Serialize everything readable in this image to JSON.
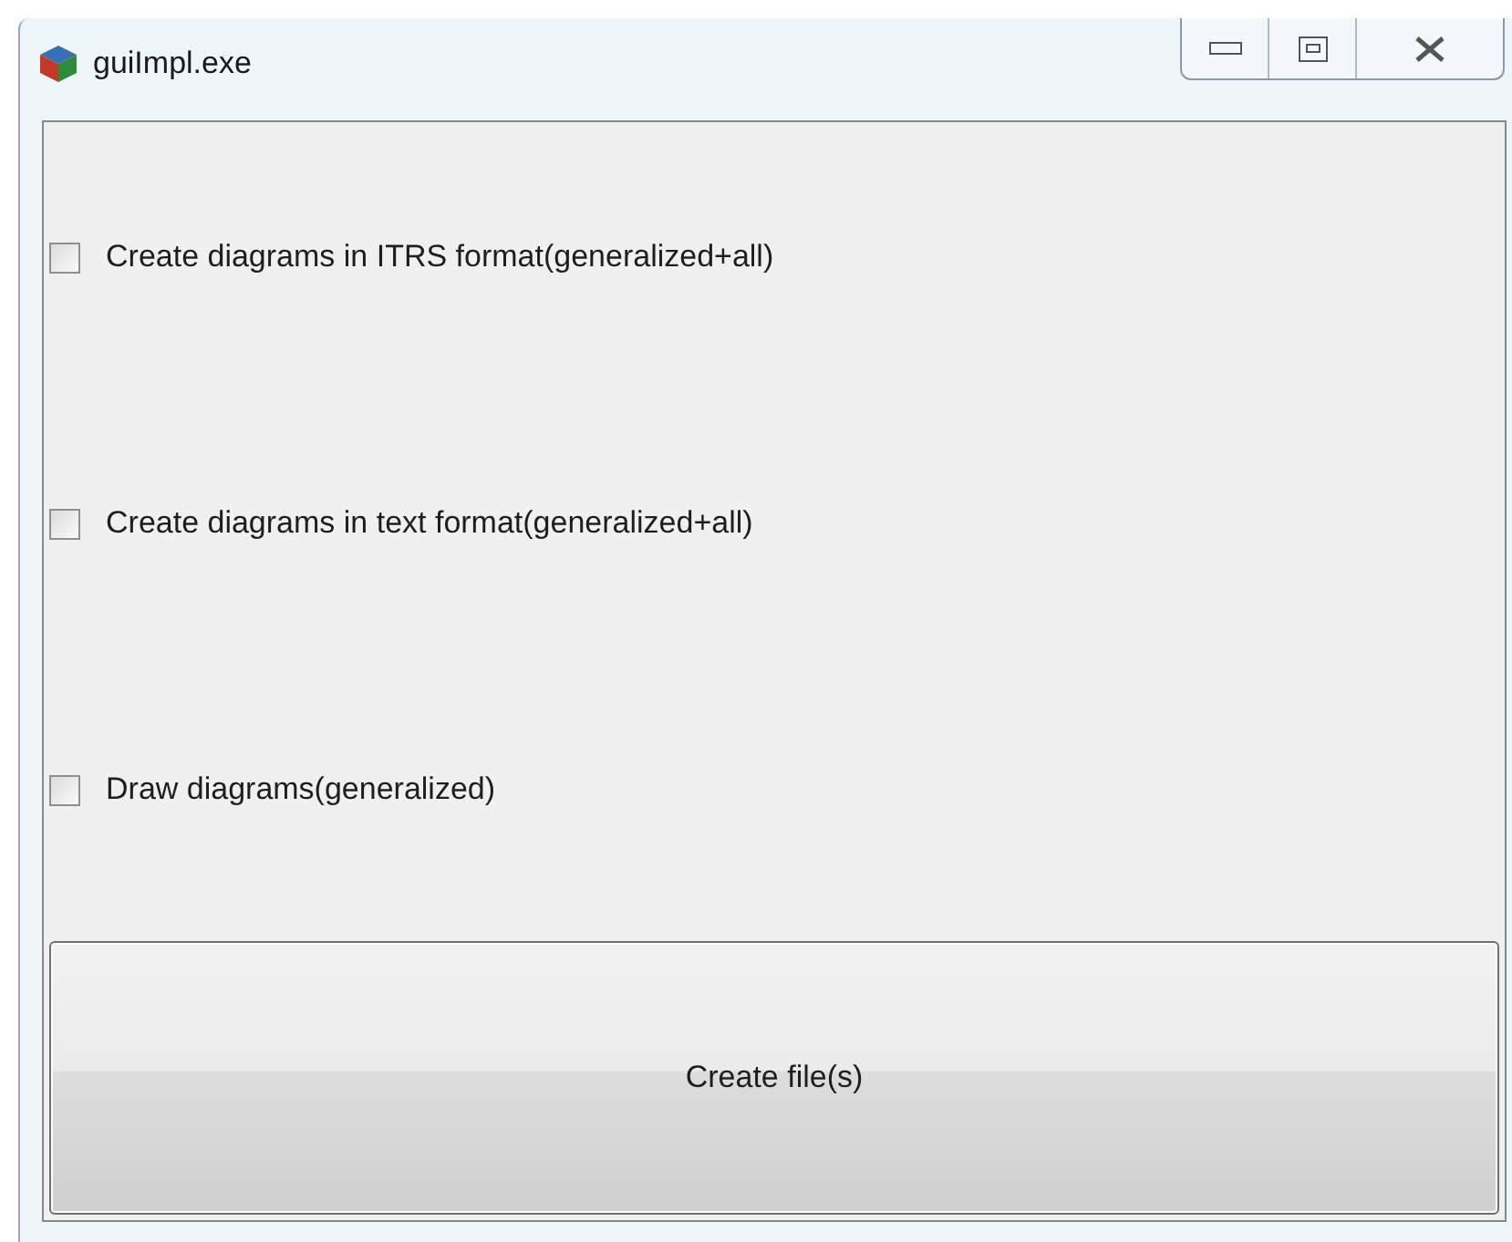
{
  "window": {
    "title": "guiImpl.exe"
  },
  "options": [
    {
      "label": "Create diagrams in ITRS format(generalized+all)",
      "checked": false
    },
    {
      "label": "Create diagrams in text format(generalized+all)",
      "checked": false
    },
    {
      "label": "Draw diagrams(generalized)",
      "checked": false
    }
  ],
  "button": {
    "label": "Create file(s)"
  }
}
